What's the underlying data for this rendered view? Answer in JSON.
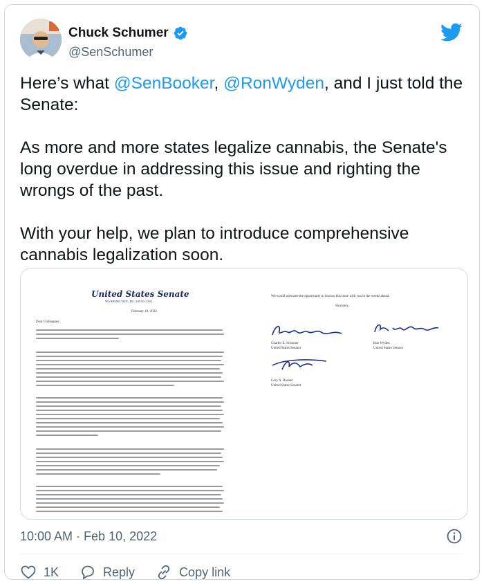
{
  "author": {
    "name": "Chuck Schumer",
    "handle": "@SenSchumer"
  },
  "tweet": {
    "line1_prefix": "Here’s what ",
    "mention1": "@SenBooker",
    "sep": ", ",
    "mention2": "@RonWyden",
    "line1_suffix": ", and I just told the Senate:",
    "para2": "As more and more states legalize cannabis, the Senate's long overdue in addressing this issue and righting the wrongs of the past.",
    "para3": "With your help, we plan to introduce comprehensive cannabis legalization soon."
  },
  "letter": {
    "letterhead": "United States Senate",
    "location": "WASHINGTON, DC 20510-3301",
    "date": "February 10, 2022",
    "salutation": "Dear Colleagues:",
    "closing_line": "We would welcome the opportunity to discuss this issue with you in the weeks ahead.",
    "closing": "Sincerely,",
    "signers": [
      {
        "name": "Charles E. Schumer",
        "title": "United States Senator"
      },
      {
        "name": "Ron Wyden",
        "title": "United States Senator"
      },
      {
        "name": "Cory A. Booker",
        "title": "United States Senator"
      }
    ]
  },
  "meta": {
    "timestamp": "10:00 AM · Feb 10, 2022"
  },
  "actions": {
    "likes": "1K",
    "reply": "Reply",
    "copy_link": "Copy link"
  },
  "colors": {
    "accent": "#1d9bf0",
    "text": "#0f1419",
    "muted": "#536471",
    "signature_ink": "#1f2d8a"
  }
}
